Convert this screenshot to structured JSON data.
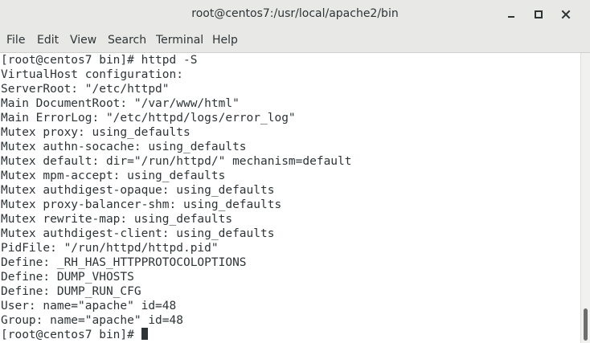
{
  "window": {
    "title": "root@centos7:/usr/local/apache2/bin"
  },
  "menu": {
    "items": [
      "File",
      "Edit",
      "View",
      "Search",
      "Terminal",
      "Help"
    ]
  },
  "terminal": {
    "lines": [
      "[root@centos7 bin]# httpd -S",
      "VirtualHost configuration:",
      "ServerRoot: \"/etc/httpd\"",
      "Main DocumentRoot: \"/var/www/html\"",
      "Main ErrorLog: \"/etc/httpd/logs/error_log\"",
      "Mutex proxy: using_defaults",
      "Mutex authn-socache: using_defaults",
      "Mutex default: dir=\"/run/httpd/\" mechanism=default",
      "Mutex mpm-accept: using_defaults",
      "Mutex authdigest-opaque: using_defaults",
      "Mutex proxy-balancer-shm: using_defaults",
      "Mutex rewrite-map: using_defaults",
      "Mutex authdigest-client: using_defaults",
      "PidFile: \"/run/httpd/httpd.pid\"",
      "Define: _RH_HAS_HTTPPROTOCOLOPTIONS",
      "Define: DUMP_VHOSTS",
      "Define: DUMP_RUN_CFG",
      "User: name=\"apache\" id=48",
      "Group: name=\"apache\" id=48"
    ],
    "prompt": "[root@centos7 bin]# "
  },
  "icons": {
    "minimize": "minimize-icon",
    "maximize": "maximize-icon",
    "close": "close-icon"
  },
  "colors": {
    "chrome": "#e8e8e7",
    "text": "#2e3436",
    "terminal_bg": "#ffffff"
  }
}
